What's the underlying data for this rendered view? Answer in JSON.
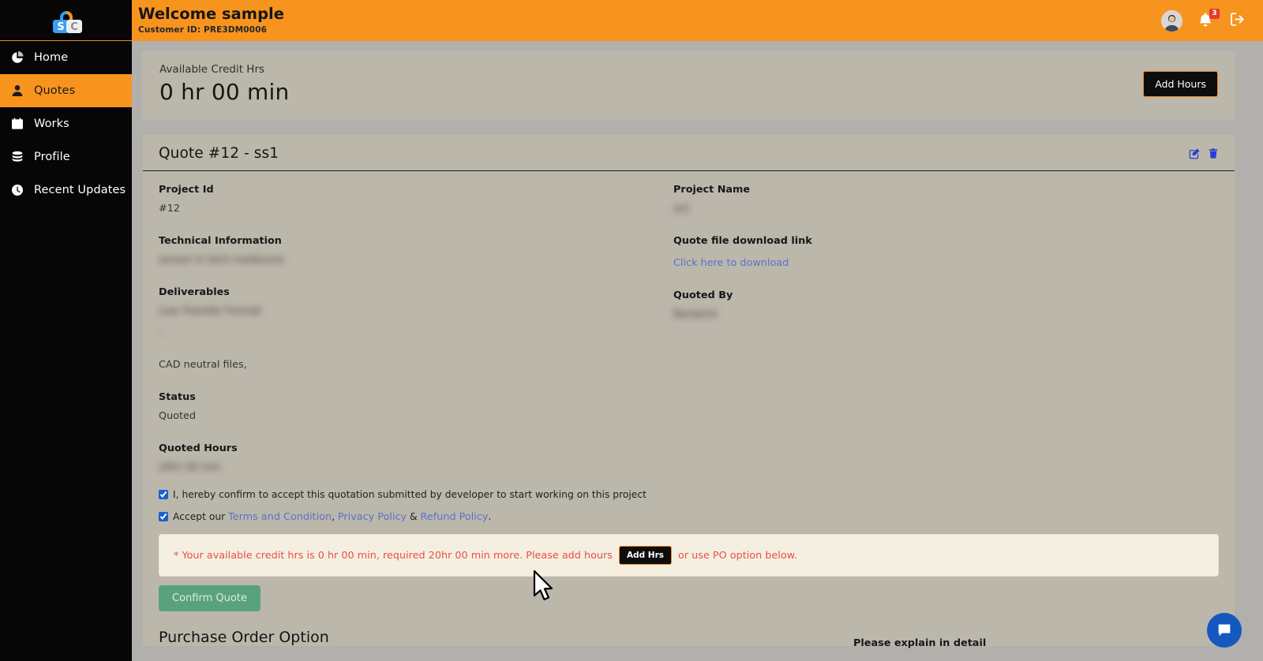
{
  "brand": {
    "logo_letters": [
      "S",
      "C"
    ],
    "accent_color": "#f7941e",
    "sidebar_color": "#060606"
  },
  "sidebar": {
    "items": [
      {
        "label": "Home",
        "icon": "pie-chart-icon",
        "active": false
      },
      {
        "label": "Quotes",
        "icon": "user-icon",
        "active": true
      },
      {
        "label": "Works",
        "icon": "calendar-icon",
        "active": false
      },
      {
        "label": "Profile",
        "icon": "database-icon",
        "active": false
      },
      {
        "label": "Recent Updates",
        "icon": "clock-icon",
        "active": false
      }
    ]
  },
  "header": {
    "welcome": "Welcome sample",
    "customer_id": "Customer ID: PRE3DM0006",
    "notification_count": "3",
    "icons": [
      "avatar",
      "bell-icon",
      "logout-icon"
    ]
  },
  "credit": {
    "label": "Available Credit Hrs",
    "value": "0 hr 00 min",
    "add_hours_label": "Add Hours"
  },
  "quote": {
    "title": "Quote #12 - ss1",
    "fields": {
      "project_id_label": "Project Id",
      "project_id_value": "#12",
      "project_name_label": "Project Name",
      "project_name_value": "ss1",
      "technical_information_label": "Technical Information",
      "technical_information_value": "sensor in tech modeume",
      "quote_file_label": "Quote file download link",
      "quote_file_link": "Click here to download",
      "deliverables_label": "Deliverables",
      "deliverables_value": "Low Transfer Format",
      "deliverables_value2": "-",
      "deliverables_note": "CAD neutral files,",
      "quoted_by_label": "Quoted By",
      "quoted_by_value": "Backend",
      "status_label": "Status",
      "status_value": "Quoted",
      "quoted_hours_label": "Quoted Hours",
      "quoted_hours_value": "20hr 00 min"
    },
    "actions": {
      "edit_icon": "edit-icon",
      "delete_icon": "trash-icon"
    }
  },
  "consent": {
    "confirm_text": "I, hereby confirm to accept this quotation submitted by developer to start working on this project",
    "confirm_checked": true,
    "accept_prefix": "Accept our ",
    "terms_link": "Terms and Condition",
    "sep1": ", ",
    "privacy_link": "Privacy Policy",
    "sep2": " & ",
    "refund_link": "Refund Policy",
    "period": ".",
    "accept_checked": true
  },
  "alert": {
    "text_before": "* Your available credit hrs is 0 hr 00 min, required 20hr 00 min more. Please add hours",
    "button_label": "Add Hrs",
    "text_after": "or use PO option below."
  },
  "footer": {
    "confirm_quote_label": "Confirm Quote",
    "purchase_order_title": "Purchase Order Option",
    "po_right_label": "Please explain in detail",
    "chat_icon": "chat-bubble-icon"
  }
}
